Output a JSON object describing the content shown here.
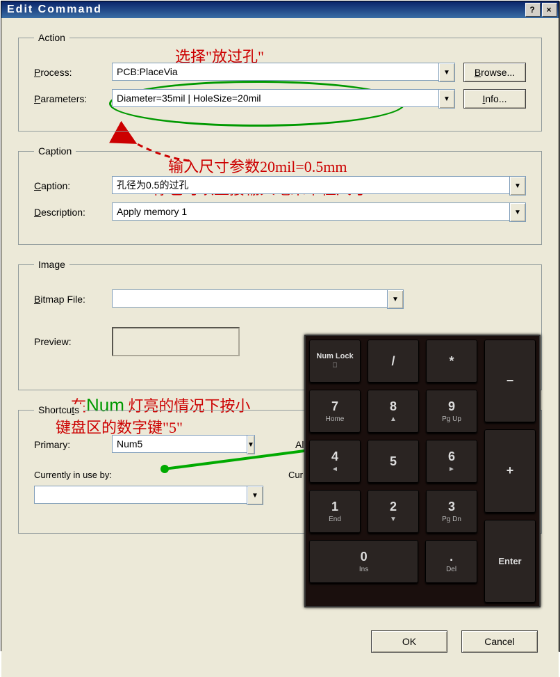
{
  "window": {
    "title": "Edit Command"
  },
  "action": {
    "legend": "Action",
    "process_label": "Process:",
    "process_value": "PCB:PlaceVia",
    "browse_label": "Browse...",
    "parameters_label": "Parameters:",
    "parameters_value": "Diameter=35mil | HoleSize=20mil",
    "info_label": "Info..."
  },
  "caption": {
    "legend": "Caption",
    "caption_label": "Caption:",
    "caption_value": "孔径为0.5的过孔",
    "description_label": "Description:",
    "description_value": "Apply memory 1"
  },
  "image": {
    "legend": "Image",
    "bitmap_label": "Bitmap File:",
    "bitmap_value": "",
    "preview_label": "Preview:"
  },
  "shortcuts": {
    "legend": "Shortcuts",
    "primary_label": "Primary:",
    "primary_value": "Num5",
    "alternate_label": "Alternate:",
    "inuse_label": "Currently in use by:",
    "inuse2_label": "Currently in use by:",
    "inuse_value": ""
  },
  "footer": {
    "ok": "OK",
    "cancel": "Cancel"
  },
  "annotations": {
    "a1": "选择\"放过孔\"",
    "a2": "输入尺寸参数20mil=0.5mm",
    "a3": "你也可以直接输入毫米单位尺寸",
    "a4_pre": "在",
    "a4_num": "Num",
    "a4_post": " 灯亮的情况下按小",
    "a5": "键盘区的数字键\"5\""
  },
  "keypad": {
    "r0": [
      {
        "main": "Num Lock",
        "sub": "⎕"
      },
      {
        "main": "/"
      },
      {
        "main": "*"
      },
      {
        "main": "−"
      }
    ],
    "r1": [
      {
        "main": "7",
        "sub": "Home"
      },
      {
        "main": "8",
        "sub": "▲"
      },
      {
        "main": "9",
        "sub": "Pg Up"
      }
    ],
    "r2": [
      {
        "main": "4",
        "sub": "◄"
      },
      {
        "main": "5"
      },
      {
        "main": "6",
        "sub": "►"
      }
    ],
    "plus": "+",
    "r3": [
      {
        "main": "1",
        "sub": "End"
      },
      {
        "main": "2",
        "sub": "▼"
      },
      {
        "main": "3",
        "sub": "Pg Dn"
      }
    ],
    "r4": [
      {
        "main": "0",
        "sub": "Ins"
      },
      {
        "main": ".",
        "sub": "Del"
      }
    ],
    "enter": "Enter"
  }
}
